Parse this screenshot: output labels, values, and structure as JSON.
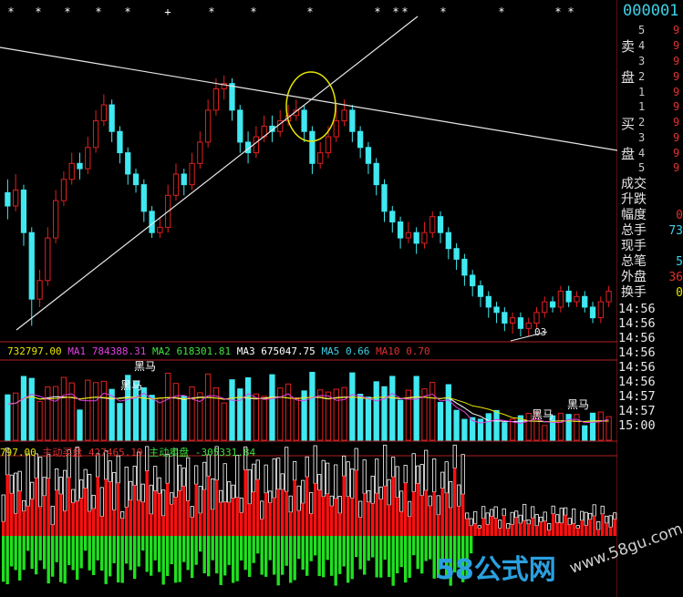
{
  "stock_code": "000001",
  "order_book": {
    "sell_label": [
      "卖",
      "盘"
    ],
    "buy_label": [
      "买",
      "盘"
    ],
    "sell_levels": [
      "5",
      "4",
      "3",
      "2",
      "1"
    ],
    "buy_levels": [
      "1",
      "2",
      "3",
      "4",
      "5"
    ],
    "sell_prices": [
      "9",
      "9",
      "9",
      "9",
      "9"
    ],
    "buy_prices": [
      "9",
      "9",
      "9",
      "9",
      "9"
    ]
  },
  "stats": [
    {
      "label": "成交",
      "value": "",
      "color": "#ffffff"
    },
    {
      "label": "升跌",
      "value": "",
      "color": "#ffffff"
    },
    {
      "label": "幅度",
      "value": "0",
      "color": "#e03030"
    },
    {
      "label": "总手",
      "value": "73",
      "color": "#3fd0e6"
    },
    {
      "label": "现手",
      "value": "",
      "color": "#ffffff"
    },
    {
      "label": "总笔",
      "value": "5",
      "color": "#3fd0e6"
    },
    {
      "label": "外盘",
      "value": "36",
      "color": "#e03030"
    },
    {
      "label": "换手",
      "value": "0",
      "color": "#e6e600"
    }
  ],
  "times": [
    "14:56",
    "14:56",
    "14:56",
    "14:56",
    "14:56",
    "14:56",
    "14:57",
    "14:57",
    "15:00"
  ],
  "vol_legend": [
    {
      "text": "732797.00",
      "color": "#e6e600"
    },
    {
      "text": "MA1",
      "color": "#e040e0"
    },
    {
      "text": "784388.31",
      "color": "#e040e0"
    },
    {
      "text": "MA2",
      "color": "#40e040"
    },
    {
      "text": "618301.81",
      "color": "#40e040"
    },
    {
      "text": "MA3",
      "color": "#ffffff"
    },
    {
      "text": "675047.75",
      "color": "#ffffff"
    },
    {
      "text": "MA5",
      "color": "#3fd0e6"
    },
    {
      "text": "0.66",
      "color": "#3fd0e6"
    },
    {
      "text": "MA10",
      "color": "#e03030"
    },
    {
      "text": "0.70",
      "color": "#e03030"
    }
  ],
  "flow_legend": [
    {
      "text": "797.00",
      "color": "#e6e600"
    },
    {
      "text": "主动买盘",
      "color": "#e03030"
    },
    {
      "text": "427465.19",
      "color": "#e03030"
    },
    {
      "text": "主动卖盘",
      "color": "#40e040"
    },
    {
      "text": "-305331.84",
      "color": "#40e040"
    }
  ],
  "annotations": [
    "黑马",
    "黑马",
    "黑马",
    "黑马"
  ],
  "last_label": "03",
  "watermark": {
    "text1": "58公式网",
    "text2": "www.58gu.com"
  },
  "colors": {
    "up": "#e02020",
    "down": "#40e8f0",
    "buy": "#ff1010",
    "sell": "#20e020",
    "line": "#ffffff",
    "ellipse": "#e6e600"
  },
  "chart_data": {
    "type": "candlestick",
    "title": "",
    "xlabel": "",
    "ylabel": "",
    "candles": [
      [
        0.55,
        0.5,
        0.6,
        0.45
      ],
      [
        0.5,
        0.56,
        0.62,
        0.48
      ],
      [
        0.56,
        0.4,
        0.58,
        0.35
      ],
      [
        0.4,
        0.15,
        0.42,
        0.05
      ],
      [
        0.15,
        0.22,
        0.26,
        0.12
      ],
      [
        0.22,
        0.38,
        0.42,
        0.2
      ],
      [
        0.38,
        0.52,
        0.56,
        0.36
      ],
      [
        0.52,
        0.6,
        0.63,
        0.5
      ],
      [
        0.6,
        0.66,
        0.7,
        0.58
      ],
      [
        0.66,
        0.64,
        0.7,
        0.6
      ],
      [
        0.64,
        0.72,
        0.76,
        0.62
      ],
      [
        0.72,
        0.82,
        0.86,
        0.7
      ],
      [
        0.82,
        0.88,
        0.92,
        0.8
      ],
      [
        0.88,
        0.78,
        0.9,
        0.74
      ],
      [
        0.78,
        0.7,
        0.8,
        0.66
      ],
      [
        0.7,
        0.62,
        0.72,
        0.58
      ],
      [
        0.62,
        0.58,
        0.64,
        0.55
      ],
      [
        0.58,
        0.48,
        0.6,
        0.44
      ],
      [
        0.48,
        0.4,
        0.5,
        0.38
      ],
      [
        0.4,
        0.42,
        0.46,
        0.38
      ],
      [
        0.42,
        0.54,
        0.58,
        0.4
      ],
      [
        0.54,
        0.62,
        0.66,
        0.52
      ],
      [
        0.62,
        0.58,
        0.64,
        0.54
      ],
      [
        0.58,
        0.66,
        0.7,
        0.56
      ],
      [
        0.66,
        0.74,
        0.78,
        0.64
      ],
      [
        0.74,
        0.86,
        0.9,
        0.72
      ],
      [
        0.86,
        0.94,
        0.98,
        0.84
      ],
      [
        0.94,
        0.96,
        0.99,
        0.9
      ],
      [
        0.96,
        0.86,
        0.98,
        0.82
      ],
      [
        0.86,
        0.74,
        0.88,
        0.7
      ],
      [
        0.74,
        0.7,
        0.78,
        0.66
      ],
      [
        0.7,
        0.76,
        0.8,
        0.68
      ],
      [
        0.76,
        0.8,
        0.84,
        0.74
      ],
      [
        0.8,
        0.78,
        0.84,
        0.74
      ],
      [
        0.78,
        0.82,
        0.86,
        0.76
      ],
      [
        0.82,
        0.84,
        0.88,
        0.8
      ],
      [
        0.84,
        0.86,
        0.9,
        0.82
      ],
      [
        0.86,
        0.78,
        0.88,
        0.74
      ],
      [
        0.78,
        0.66,
        0.8,
        0.62
      ],
      [
        0.66,
        0.7,
        0.74,
        0.64
      ],
      [
        0.7,
        0.76,
        0.8,
        0.68
      ],
      [
        0.76,
        0.82,
        0.88,
        0.74
      ],
      [
        0.82,
        0.86,
        0.9,
        0.8
      ],
      [
        0.86,
        0.78,
        0.88,
        0.74
      ],
      [
        0.78,
        0.72,
        0.8,
        0.68
      ],
      [
        0.72,
        0.66,
        0.74,
        0.62
      ],
      [
        0.66,
        0.58,
        0.68,
        0.54
      ],
      [
        0.58,
        0.48,
        0.6,
        0.44
      ],
      [
        0.48,
        0.44,
        0.5,
        0.4
      ],
      [
        0.44,
        0.38,
        0.46,
        0.34
      ],
      [
        0.38,
        0.4,
        0.44,
        0.36
      ],
      [
        0.4,
        0.36,
        0.42,
        0.32
      ],
      [
        0.36,
        0.4,
        0.44,
        0.34
      ],
      [
        0.4,
        0.46,
        0.48,
        0.38
      ],
      [
        0.46,
        0.4,
        0.48,
        0.36
      ],
      [
        0.4,
        0.34,
        0.42,
        0.3
      ],
      [
        0.34,
        0.3,
        0.36,
        0.26
      ],
      [
        0.3,
        0.24,
        0.32,
        0.2
      ],
      [
        0.24,
        0.2,
        0.26,
        0.16
      ],
      [
        0.2,
        0.16,
        0.22,
        0.12
      ],
      [
        0.16,
        0.12,
        0.18,
        0.08
      ],
      [
        0.12,
        0.1,
        0.14,
        0.06
      ],
      [
        0.1,
        0.06,
        0.12,
        0.03
      ],
      [
        0.06,
        0.08,
        0.1,
        0.02
      ],
      [
        0.08,
        0.04,
        0.1,
        0.01
      ],
      [
        0.04,
        0.06,
        0.08,
        0.01
      ],
      [
        0.06,
        0.1,
        0.12,
        0.04
      ],
      [
        0.1,
        0.14,
        0.16,
        0.08
      ],
      [
        0.14,
        0.12,
        0.16,
        0.1
      ],
      [
        0.12,
        0.18,
        0.2,
        0.1
      ],
      [
        0.18,
        0.14,
        0.2,
        0.12
      ],
      [
        0.14,
        0.16,
        0.18,
        0.12
      ],
      [
        0.16,
        0.12,
        0.18,
        0.1
      ],
      [
        0.12,
        0.08,
        0.14,
        0.06
      ],
      [
        0.08,
        0.14,
        0.16,
        0.06
      ],
      [
        0.14,
        0.18,
        0.2,
        0.12
      ]
    ]
  }
}
